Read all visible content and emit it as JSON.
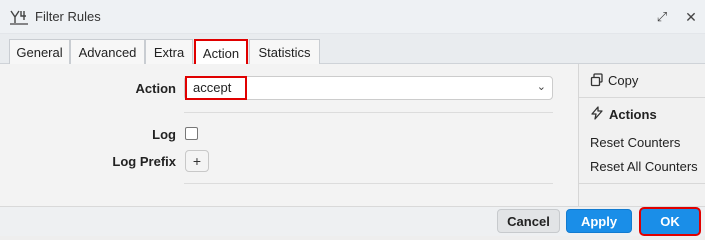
{
  "window": {
    "title": "Filter Rules",
    "icons": {
      "app": "filter-rules-icon",
      "restore": "restore-icon",
      "close": "close-icon"
    },
    "restore_glyph": "⤢",
    "close_glyph": "✕"
  },
  "tabs": [
    {
      "label": "General"
    },
    {
      "label": "Advanced"
    },
    {
      "label": "Extra"
    },
    {
      "label": "Action",
      "active": true,
      "highlighted": true
    },
    {
      "label": "Statistics"
    }
  ],
  "form": {
    "action_label": "Action",
    "action_value": "accept",
    "log_label": "Log",
    "log_checked": false,
    "log_prefix_label": "Log Prefix",
    "plus_glyph": "+",
    "chevron_glyph": "⌄"
  },
  "side_panel": {
    "copy_label": "Copy",
    "actions_heading": "Actions",
    "items": [
      "Reset Counters",
      "Reset All Counters"
    ],
    "icons": {
      "copy": "copy-icon",
      "actions": "lightning-icon"
    }
  },
  "footer": {
    "cancel_label": "Cancel",
    "apply_label": "Apply",
    "ok_label": "OK"
  },
  "colors": {
    "accent": "#1a8ee8",
    "highlight": "#e00000"
  }
}
